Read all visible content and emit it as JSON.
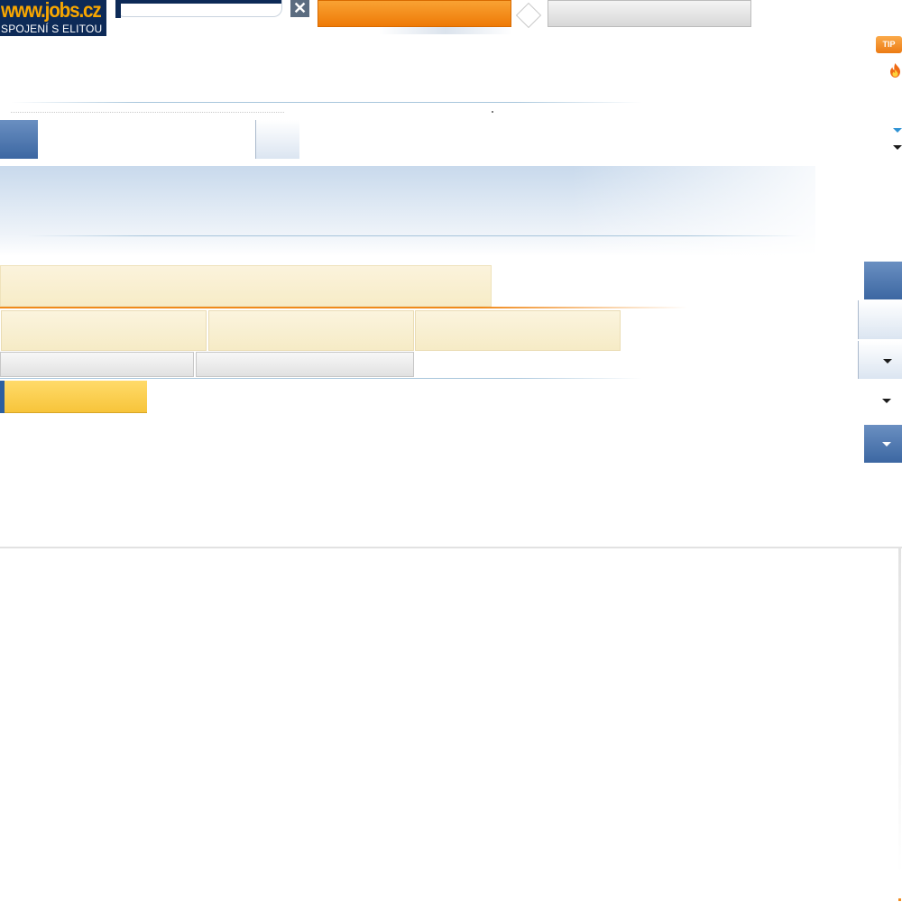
{
  "header": {
    "logo_url_text": "www.jobs.cz",
    "logo_tagline": "SPOJENÍ S ELITOU",
    "search_value": "",
    "clear_symbol": "✕",
    "primary_button_label": "",
    "secondary_button_label": ""
  },
  "badges": {
    "tip_label": "TIP"
  },
  "icons": {
    "clear": "close-icon",
    "tip": "tip-badge",
    "hot": "flame-icon",
    "dropdown": "caret-down-icon"
  },
  "colors": {
    "brand_navy": "#0d2a57",
    "brand_orange": "#f7a600",
    "cta_orange": "#ee7a06",
    "cta_yellow": "#f7c43a",
    "nav_blue": "#3c67a2",
    "accent_cyan": "#2e92d4"
  }
}
